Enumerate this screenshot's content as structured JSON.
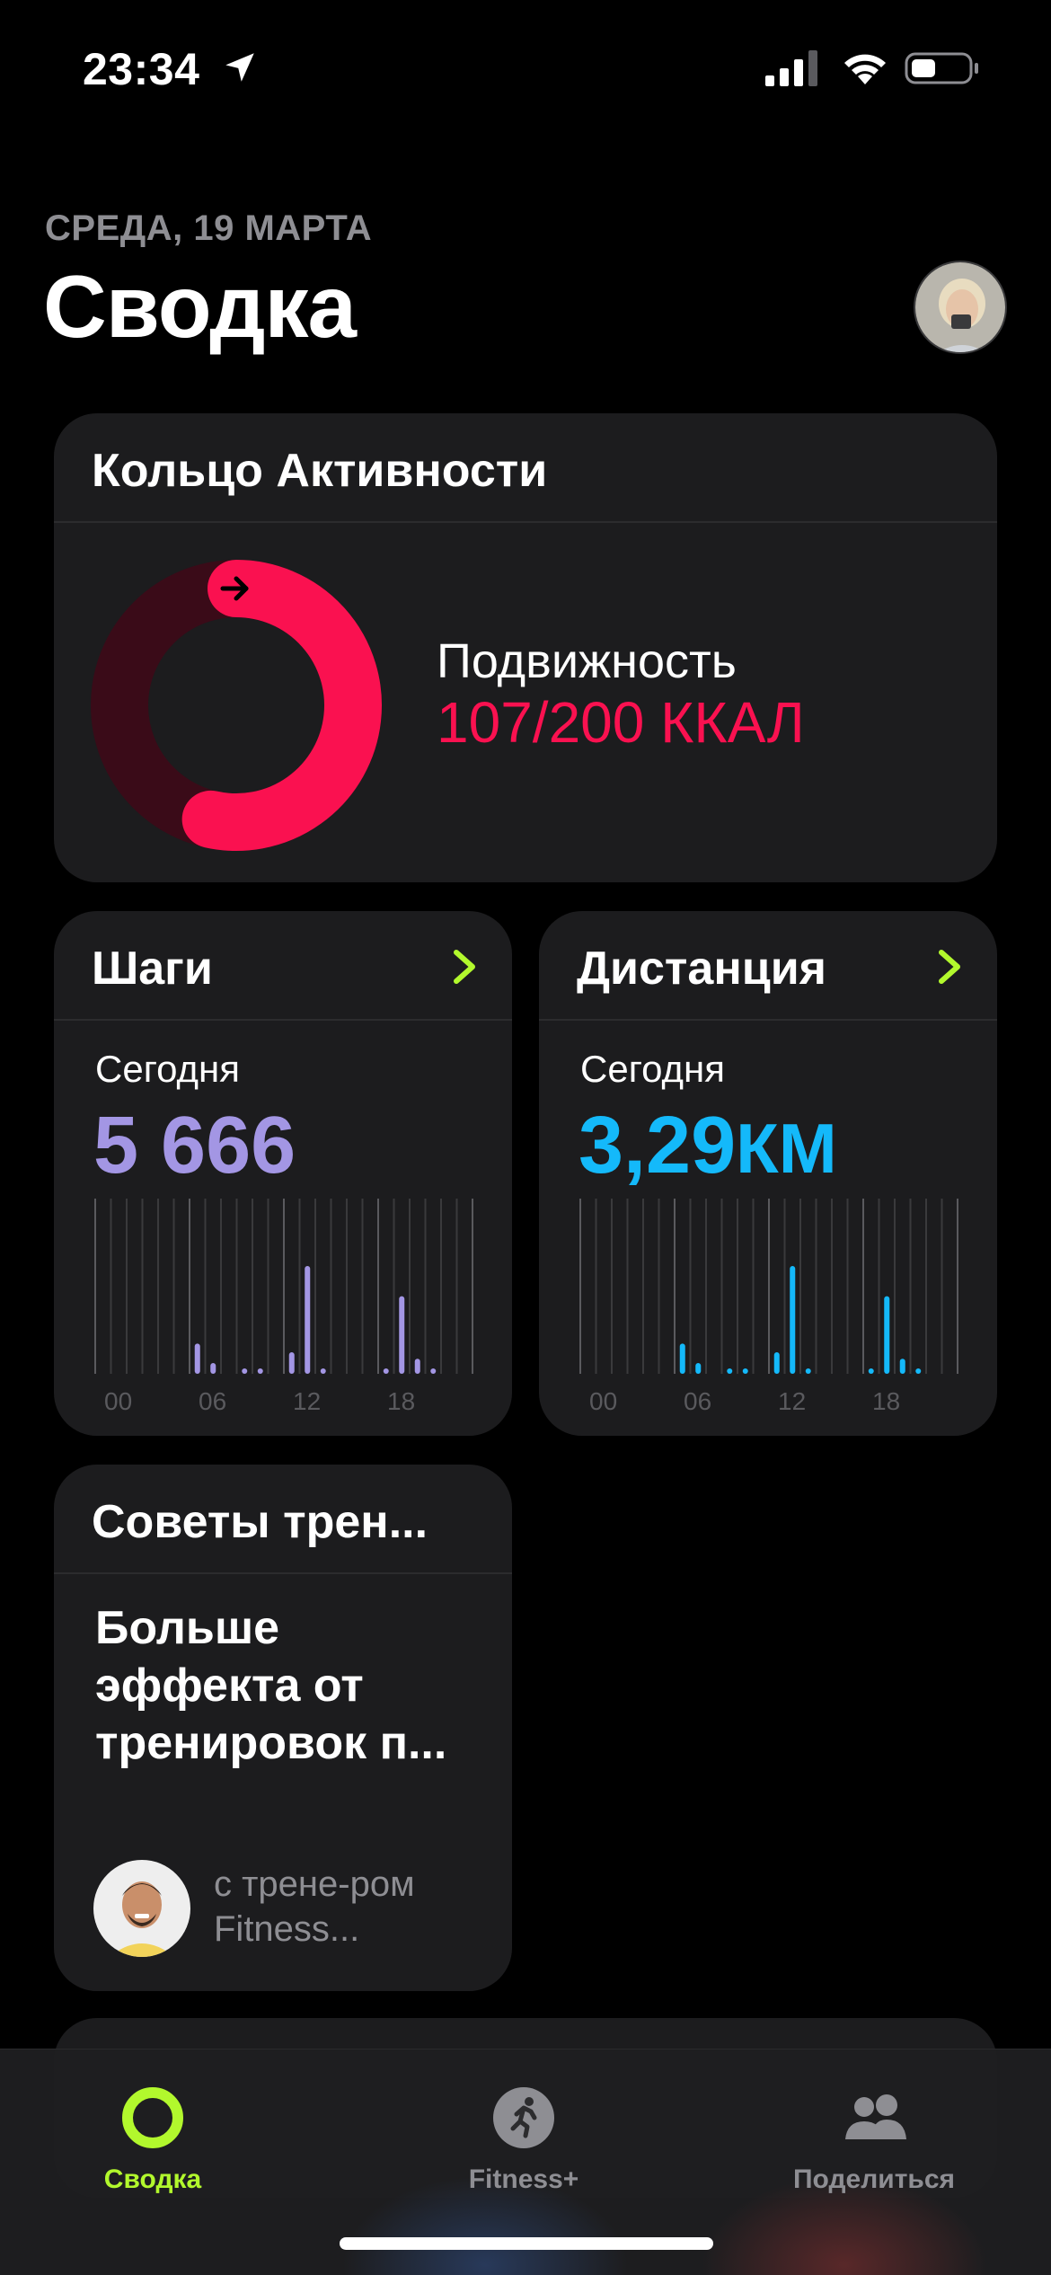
{
  "status_bar": {
    "time": "23:34",
    "icons": [
      "location-arrow-icon",
      "cellular-signal-icon",
      "wifi-icon",
      "battery-icon"
    ]
  },
  "header": {
    "date": "СРЕДА, 19 МАРТА",
    "title": "Сводка"
  },
  "activity_card": {
    "title": "Кольцо Активности",
    "move_label": "Подвижность",
    "move_value": "107/200 ККАЛ",
    "move_progress": 0.535,
    "ring_color": "#fa1150"
  },
  "steps_card": {
    "title": "Шаги",
    "today_label": "Сегодня",
    "value": "5 666",
    "accent": "#a396e4",
    "hours": [
      "00",
      "06",
      "12",
      "18"
    ]
  },
  "distance_card": {
    "title": "Дистанция",
    "today_label": "Сегодня",
    "value": "3,29",
    "unit": "КМ",
    "accent": "#14b9fa",
    "hours": [
      "00",
      "06",
      "12",
      "18"
    ]
  },
  "tips_card": {
    "title": "Советы трен...",
    "text": "Больше эффекта от тренировок п...",
    "trainer_text": "с трене-ром Fitness..."
  },
  "tab_bar": {
    "tabs": [
      {
        "label": "Сводка",
        "icon": "activity-ring-icon",
        "active": true
      },
      {
        "label": "Fitness+",
        "icon": "running-figure-icon",
        "active": false
      },
      {
        "label": "Поделиться",
        "icon": "people-icon",
        "active": false
      }
    ]
  },
  "colors": {
    "accent_green": "#b2f82d",
    "move_red": "#fa1150",
    "card_bg": "#1c1c1e"
  }
}
